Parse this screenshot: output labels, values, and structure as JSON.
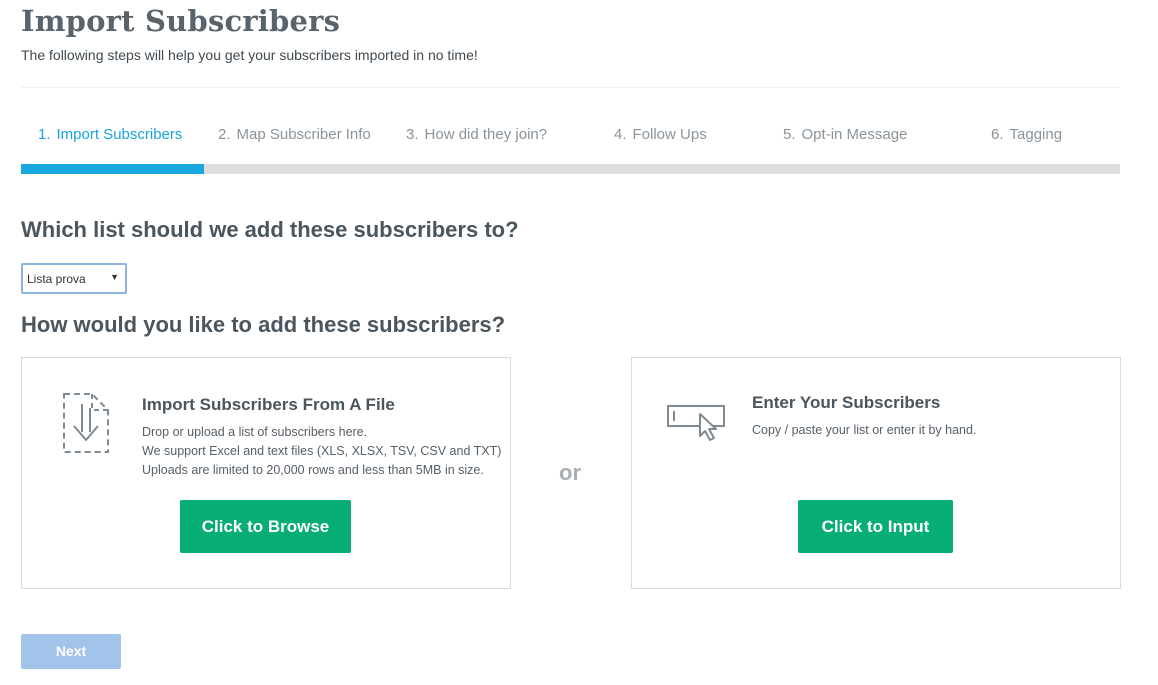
{
  "header": {
    "title": "Import Subscribers",
    "subtitle": "The following steps will help you get your subscribers imported in no time!"
  },
  "steps": [
    {
      "number": "1.",
      "label": "Import Subscribers",
      "active": true
    },
    {
      "number": "2.",
      "label": "Map Subscriber Info",
      "active": false
    },
    {
      "number": "3.",
      "label": "How did they join?",
      "active": false
    },
    {
      "number": "4.",
      "label": "Follow Ups",
      "active": false
    },
    {
      "number": "5.",
      "label": "Opt-in Message",
      "active": false
    },
    {
      "number": "6.",
      "label": "Tagging",
      "active": false
    }
  ],
  "progress": {
    "fraction": 0.1667
  },
  "list_question": {
    "heading": "Which list should we add these subscribers to?",
    "selected": "Lista prova"
  },
  "method_question": {
    "heading": "How would you like to add these subscribers?"
  },
  "file_option": {
    "title": "Import Subscribers From A File",
    "lines": [
      "Drop or upload a list of subscribers here.",
      "We support Excel and text files (XLS, XLSX, TSV, CSV and TXT)",
      "Uploads are limited to 20,000 rows and less than 5MB in size."
    ],
    "button": "Click to Browse",
    "icon": "file-import-icon"
  },
  "separator": "or",
  "input_option": {
    "title": "Enter Your Subscribers",
    "lines": [
      "Copy / paste your list or enter it by hand."
    ],
    "button": "Click to Input",
    "icon": "text-input-cursor-icon"
  },
  "footer": {
    "next_label": "Next"
  },
  "colors": {
    "accent": "#18a7df",
    "green": "#06ad74",
    "next_disabled": "#a3c4ea",
    "track": "#dcdedf"
  }
}
